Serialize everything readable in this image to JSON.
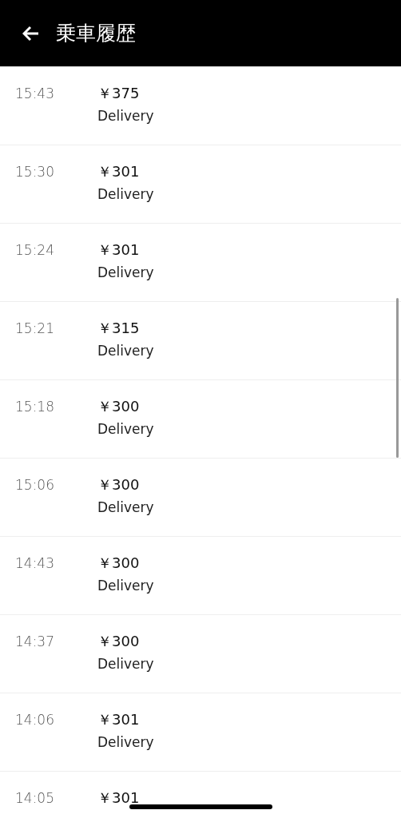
{
  "header": {
    "title": "乗車履歴"
  },
  "trips": [
    {
      "time": "15:43",
      "amount": "￥375",
      "type": "Delivery"
    },
    {
      "time": "15:30",
      "amount": "￥301",
      "type": "Delivery"
    },
    {
      "time": "15:24",
      "amount": "￥301",
      "type": "Delivery"
    },
    {
      "time": "15:21",
      "amount": "￥315",
      "type": "Delivery"
    },
    {
      "time": "15:18",
      "amount": "￥300",
      "type": "Delivery"
    },
    {
      "time": "15:06",
      "amount": "￥300",
      "type": "Delivery"
    },
    {
      "time": "14:43",
      "amount": "￥300",
      "type": "Delivery"
    },
    {
      "time": "14:37",
      "amount": "￥300",
      "type": "Delivery"
    },
    {
      "time": "14:06",
      "amount": "￥301",
      "type": "Delivery"
    },
    {
      "time": "14:05",
      "amount": "￥301"
    }
  ]
}
